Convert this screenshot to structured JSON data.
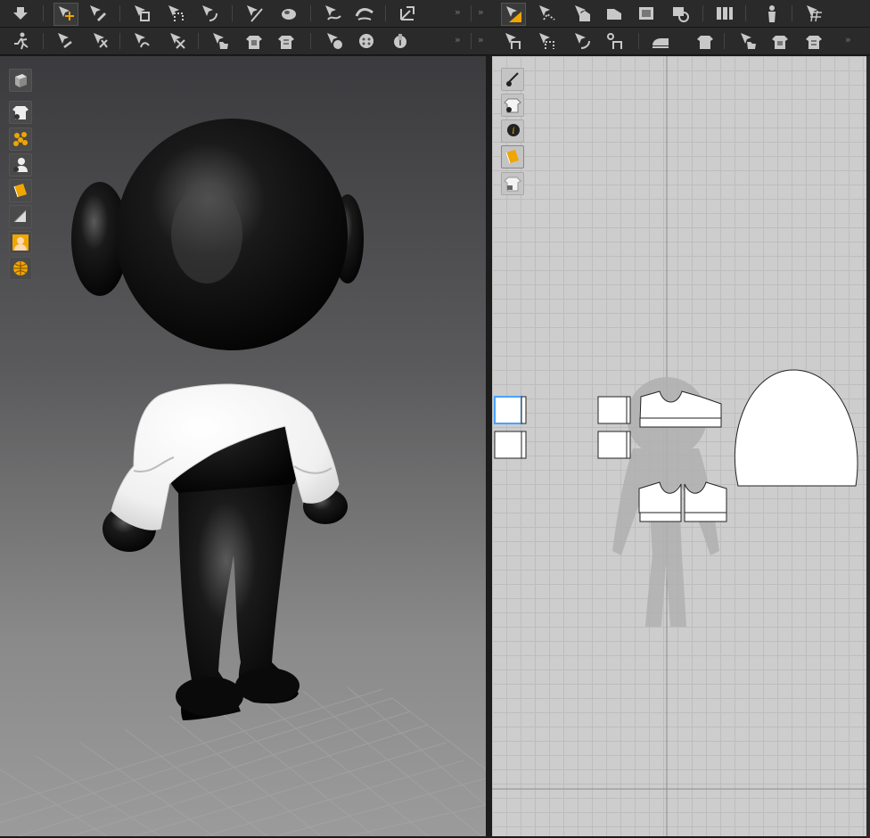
{
  "colors": {
    "accent_orange": "#f0a500",
    "toolbar_bg": "#2a2a2a",
    "icon_gray": "#c8c8c8",
    "avatar_black": "#050505",
    "garment_white": "#ffffff",
    "pattern_canvas": "#cdcdcd",
    "selection_blue": "#4aa3ff"
  },
  "toolbar_top": {
    "more_label": "»",
    "tools": [
      "select-move-icon",
      "transform-icon",
      "fold-arrange-icon",
      "segment-arrange-icon",
      "pin-icon",
      "tack-icon",
      "gizmo-icon",
      "strap-icon",
      "avatar-measure-icon",
      "edit-pattern-icon",
      "transform-pattern-icon",
      "edit-curvature-icon",
      "polygon-icon",
      "rectangle-icon",
      "internal-rectangle-icon",
      "dart-icon",
      "sewing-icon",
      "trace-icon",
      "grid-pattern-icon"
    ]
  },
  "toolbar_bottom": {
    "more_label": "»",
    "tools": [
      "avatar-pose-icon",
      "fold-icon",
      "fold-angle-icon",
      "edit-fold-icon",
      "fold-cut-icon",
      "garment-tack-icon",
      "garment-fit-icon",
      "garment-lock-icon",
      "button-icon",
      "buttonhole-icon",
      "zipper-icon",
      "segment-sewing-icon",
      "free-sewing-icon",
      "edit-sewing-icon",
      "check-sewing-icon",
      "iron-icon",
      "shirt-icon",
      "steam-icon",
      "fabric-icon",
      "solid-fabric-icon"
    ]
  },
  "view3d_sidebar": [
    "view-cube-icon",
    "show-garment-icon",
    "particle-distance-icon",
    "show-avatar-icon",
    "texture-view-icon",
    "thin-view-icon",
    "avatar-skin-icon",
    "environment-icon"
  ],
  "view2d_sidebar": [
    "show-internal-lines-icon",
    "show-baseline-icon",
    "pattern-info-icon",
    "texture-2d-icon",
    "lock-pattern-icon"
  ]
}
